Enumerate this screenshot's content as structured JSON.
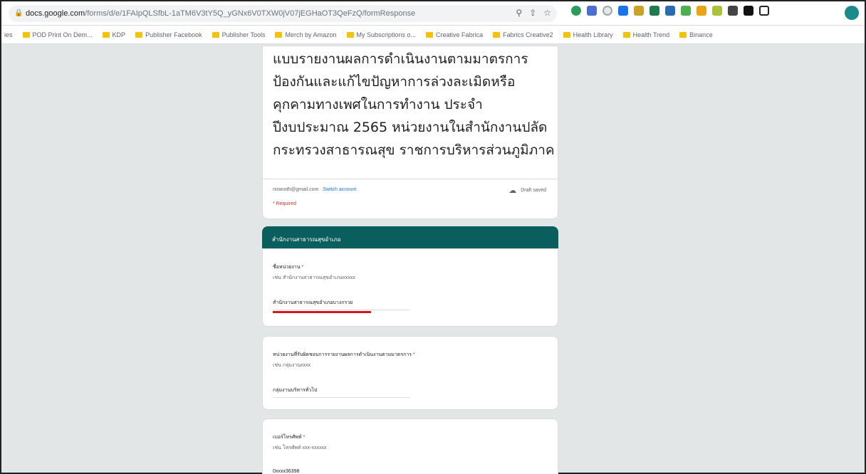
{
  "browser": {
    "url_host": "docs.google.com",
    "url_path": "/forms/d/e/1FAIpQLSfbL-1aTM6V3tY5Q_yGNx6V0TXW0jV07jEGHaOT3QeFzQ/formResponse"
  },
  "bookmarks": [
    "POD Print On Dem...",
    "KDP",
    "Publisher Facebook",
    "Publisher Tools",
    "Merch by Amazon",
    "My Subscriptions o...",
    "Creative Fabrica",
    "Fabrics Creative2",
    "Health Library",
    "Health Trend",
    "Binance"
  ],
  "bookmarks_prefix": "ies",
  "form": {
    "title": "แบบรายงานผลการดำเนินงานตามมาตรการป้องกันและแก้ไขปัญหาการล่วงละเมิดหรือคุกคามทางเพศในการทำงาน ประจำปีงบประมาณ 2565 หน่วยงานในสำนักงานปลัดกระทรวงสาธารณสุข ราชการบริหารส่วนภูมิภาค",
    "account_email": "niranoth@gmail.com",
    "switch_account": "Switch account",
    "draft_saved": "Draft saved",
    "required_note": "* Required"
  },
  "section": {
    "title": "สำนักงานสาธารณสุขอำเภอ"
  },
  "questions": [
    {
      "title": "ชื่อหน่วยงาน",
      "required_mark": "*",
      "help": "เช่น สำนักงานสาธารณสุขอำเภอxxxxx",
      "answer": "สำนักงานสาธารณสุขอำเภอบางกรวย"
    },
    {
      "title": "หน่วยงานที่รับผิดชอบการรายงานผลการดำเนินงานตามมาตรการ",
      "required_mark": "*",
      "help": "เช่น กลุ่มงานxxxx",
      "answer": "กลุ่มงานบริหารทั่วไป"
    },
    {
      "title": "เบอร์โทรศัพท์",
      "required_mark": "*",
      "help": "เช่น โทรศัพท์ xxx-xxxxxx",
      "answer": "0xxxx36398"
    }
  ]
}
